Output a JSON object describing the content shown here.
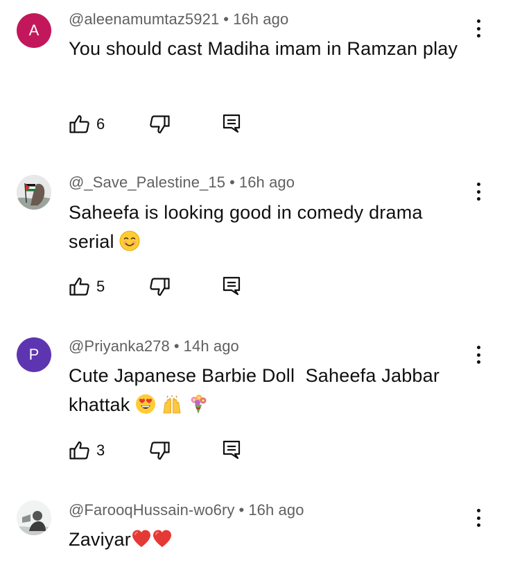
{
  "comments": [
    {
      "handle": "@aleenamumtaz5921",
      "time": "16h ago",
      "text": "You should cast Madiha imam in Ramzan play",
      "likes": "6",
      "avatar": {
        "type": "letter",
        "letter": "A",
        "color": "#c2185b"
      }
    },
    {
      "handle": "@_Save_Palestine_15",
      "time": "16h ago",
      "text": "Saheefa is looking good in comedy drama serial",
      "emojis": [
        "smiling-face-emoji"
      ],
      "likes": "5",
      "avatar": {
        "type": "photo",
        "icon": "palestine-flag-photo"
      }
    },
    {
      "handle": "@Priyanka278",
      "time": "14h ago",
      "text": "Cute Japanese Barbie Doll  Saheefa Jabbar khattak",
      "emojis": [
        "heart-eyes-emoji",
        "raising-hands-emoji",
        "bouquet-emoji"
      ],
      "likes": "3",
      "avatar": {
        "type": "letter",
        "letter": "P",
        "color": "#5e35b1"
      }
    },
    {
      "handle": "@FarooqHussain-wo6ry",
      "time": "16h ago",
      "text": "Zaviyar",
      "emojis": [
        "red-heart-emoji",
        "red-heart-emoji"
      ],
      "avatar": {
        "type": "photo",
        "icon": "person-photo"
      }
    }
  ],
  "separator": "•",
  "colors": {
    "text": "#0f0f0f",
    "meta": "#606060",
    "avatar_a": "#c2185b",
    "avatar_p": "#5e35b1"
  }
}
